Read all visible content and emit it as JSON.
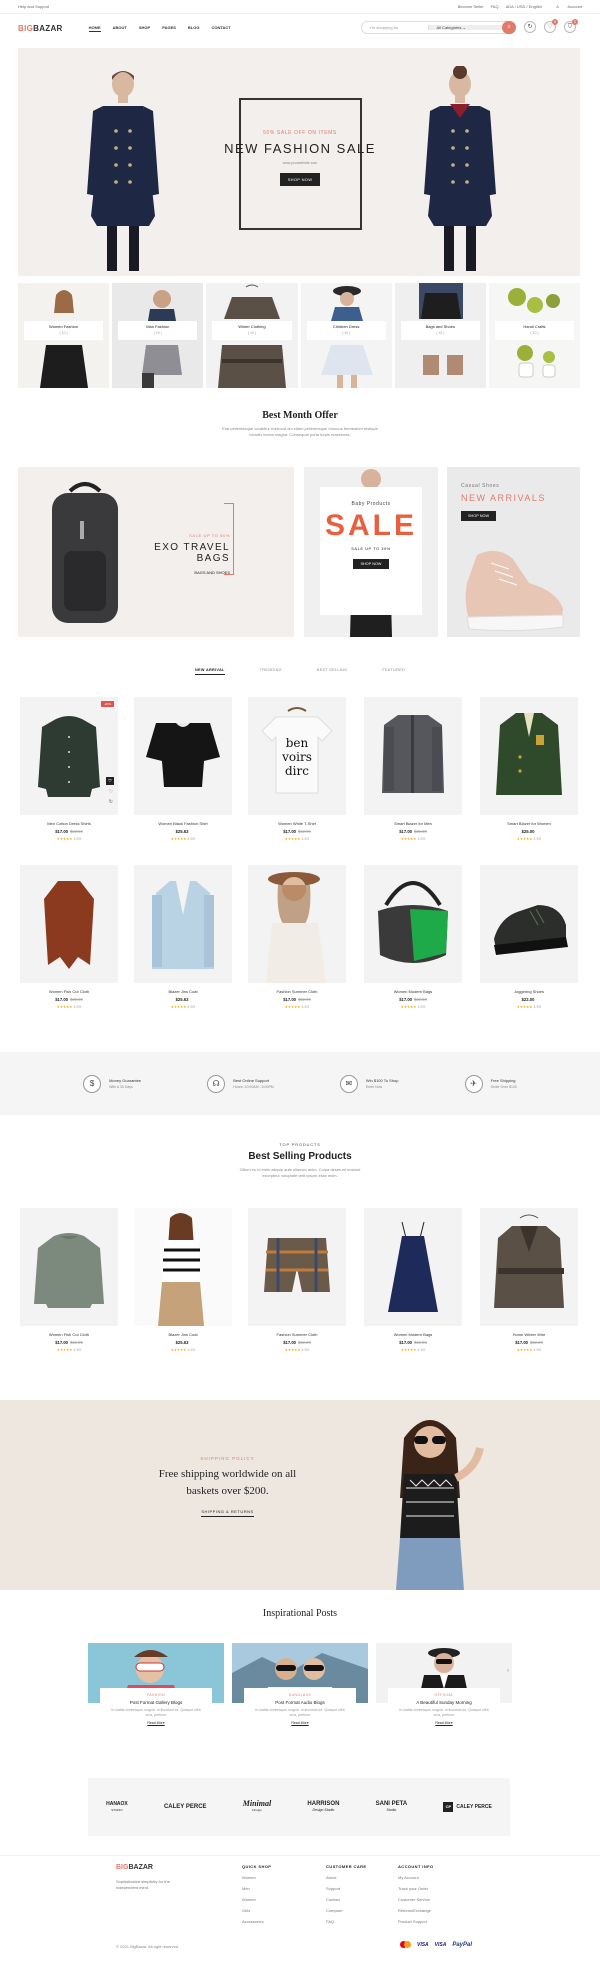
{
  "topbar": {
    "left": "Help and Support",
    "become_seller": "Become Seller",
    "faq": "FAQ",
    "locale": "ADA / USD / English",
    "account": "Account"
  },
  "header": {
    "logo_a": "BIG",
    "logo_b": "BAZAR",
    "nav": [
      "HOME",
      "ABOUT",
      "SHOP",
      "PAGES",
      "BLOG",
      "CONTACT"
    ],
    "search_placeholder": "I'm shopping for",
    "search_category": "All Categories",
    "cart_count": "0",
    "wish_count": "0"
  },
  "hero": {
    "subtitle": "50% SALE OFF ON ITEMS",
    "title": "NEW FASHION SALE",
    "website": "www.yourwebsite.com",
    "button": "SHOP NOW"
  },
  "categories": [
    {
      "name": "Women Fashion",
      "count": "( 10 )"
    },
    {
      "name": "Man Fashion",
      "count": "( 10 )"
    },
    {
      "name": "Winter Clothing",
      "count": "( 10 )"
    },
    {
      "name": "Children Dress",
      "count": "( 10 )"
    },
    {
      "name": "Bags and Shoes",
      "count": "( 10 )"
    },
    {
      "name": "Handi Crafts",
      "count": "( 10 )"
    }
  ],
  "offer": {
    "title": "Best Month Offer",
    "desc1": "Erat pellentesque curabitur euismod dui etiam pellentesque rhoncus fermentum tristique",
    "desc2": "lobortis lectus magna. Consequat porta turpis maecenas."
  },
  "banners": {
    "bags": {
      "kicker": "SALE UP TO 50%",
      "title": "EXO TRAVEL BAGS",
      "sub": "BAGS AND SHOES"
    },
    "sale": {
      "kicker": "Baby Products",
      "title": "SALE",
      "sub": "SALE UP TO 30%",
      "button": "SHOP NOW"
    },
    "shoes": {
      "kicker": "Casual Shoes",
      "title": "NEW ARRIVALS",
      "button": "SHOP NOW"
    }
  },
  "tabs": [
    "NEW ARRIVAL",
    "TRENDING",
    "BEST SELLING",
    "FEATURED"
  ],
  "products_row1": [
    {
      "name": "Men Cotton Dress Shirts",
      "price": "$17.00",
      "old": "$22.00",
      "rating": "★★★★★",
      "reviews": "4.9/5",
      "badge": "-20%"
    },
    {
      "name": "Women Black Fashion Shirt",
      "price": "$25.63",
      "old": "",
      "rating": "★★★★★",
      "reviews": "4.9/5"
    },
    {
      "name": "Women White T-Shirt",
      "price": "$17.00",
      "old": "$22.00",
      "rating": "★★★★★",
      "reviews": "4.9/5"
    },
    {
      "name": "Smart Blazer for Men",
      "price": "$17.00",
      "old": "$22.00",
      "rating": "★★★★★",
      "reviews": "4.9/5"
    },
    {
      "name": "Smart Blazer for Women",
      "price": "$25.00",
      "old": "",
      "rating": "★★★★★",
      "reviews": "4.9/5"
    }
  ],
  "products_row2": [
    {
      "name": "Women Fish Cut Cloth",
      "price": "$17.00",
      "old": "$22.00",
      "rating": "★★★★★",
      "reviews": "4.9/5"
    },
    {
      "name": "Blazer Jins Coat",
      "price": "$25.63",
      "old": "",
      "rating": "★★★★★",
      "reviews": "4.9/5"
    },
    {
      "name": "Fashion Summer Cloth",
      "price": "$17.00",
      "old": "$22.00",
      "rating": "★★★★★",
      "reviews": "4.9/5"
    },
    {
      "name": "Women Modern Bags",
      "price": "$17.00",
      "old": "$22.00",
      "rating": "★★★★★",
      "reviews": "4.9/5"
    },
    {
      "name": "Joggering Shoes",
      "price": "$22.00",
      "old": "",
      "rating": "★★★★★",
      "reviews": "4.9/5"
    }
  ],
  "features": [
    {
      "title": "Money Guarantee",
      "sub": "With A 30 Days",
      "icon": "money-icon"
    },
    {
      "title": "Best Online Support",
      "sub": "Hours: 10:00AM - 5:00PM",
      "icon": "headset-icon"
    },
    {
      "title": "Win $100 To Shop",
      "sub": "Enter Now",
      "icon": "gift-icon"
    },
    {
      "title": "Free Shipping",
      "sub": "Order Over $100",
      "icon": "plane-icon"
    }
  ],
  "bestselling": {
    "kicker": "TOP PRODUCTS",
    "title": "Best Selling Products",
    "desc1": "Cillum eu id enim aliquip aute ullamco anim. Culpa deserunt nostrud",
    "desc2": "excepteur voluptate velit ipsum esse enim."
  },
  "products_best": [
    {
      "name": "Women Fish Cut Cloth",
      "price": "$17.00",
      "old": "$22.00",
      "rating": "★★★★★",
      "reviews": "4.9/5"
    },
    {
      "name": "Blazer Jins Coat",
      "price": "$25.63",
      "old": "",
      "rating": "★★★★★",
      "reviews": "4.9/5"
    },
    {
      "name": "Fashion Summer Cloth",
      "price": "$17.00",
      "old": "$22.00",
      "rating": "★★★★★",
      "reviews": "4.9/5"
    },
    {
      "name": "Women Modern Bags",
      "price": "$17.00",
      "old": "$22.00",
      "rating": "★★★★★",
      "reviews": "4.9/5"
    },
    {
      "name": "Home Winter Wire",
      "price": "$17.00",
      "old": "$22.00",
      "rating": "★★★★★",
      "reviews": "4.9/5"
    }
  ],
  "shipping": {
    "kicker": "SHIPPING POLICY",
    "title1": "Free shipping worldwide on all",
    "title2": "baskets over $200.",
    "link": "SHIPPING & RETURNS"
  },
  "posts": {
    "title": "Inspirational Posts",
    "items": [
      {
        "cat": "FASHION",
        "title": "Post Format Gallery Blogs",
        "desc": "In mattis scelerisque magna, ut tincidunt ex. Quisque nibh urna, pretium.",
        "more": "Read More"
      },
      {
        "cat": "SUNGLASS",
        "title": "Post Format Audio Blogs",
        "desc": "In mattis scelerisque magna, ut tincidunt ex. Quisque nibh urna, pretium.",
        "more": "Read More"
      },
      {
        "cat": "OFFICIAL",
        "title": "A Beautiful Sunday Morning",
        "desc": "In mattis scelerisque magna, ut tincidunt ex. Quisque nibh urna, pretium.",
        "more": "Read More"
      }
    ]
  },
  "brands": [
    {
      "name": "HANAOX",
      "sub": "STUDIO"
    },
    {
      "name": "CALEY PERCE",
      "sub": ""
    },
    {
      "name": "Minimal",
      "sub": "Design"
    },
    {
      "name": "HARRISON",
      "sub": "Design Studio"
    },
    {
      "name": "SANI PETA",
      "sub": "Studio"
    },
    {
      "name": "CALEY PERCE",
      "sub": ""
    }
  ],
  "footer": {
    "logo_a": "BIG",
    "logo_b": "BAZAR",
    "about1": "Sophisticated simplicity for the",
    "about2": "independent mind.",
    "cols": [
      {
        "title": "QUICK SHOP",
        "items": [
          "Women",
          "Men",
          "Women",
          "Girls",
          "Accessories"
        ]
      },
      {
        "title": "CUSTOMER CARE",
        "items": [
          "About",
          "Support",
          "Contact",
          "Compare",
          "FAQ"
        ]
      },
      {
        "title": "ACCOUNT INFO",
        "items": [
          "My Account",
          "Track your Order",
          "Customer Service",
          "Returns/Exchange",
          "Product Support"
        ]
      }
    ],
    "copyright": "© 2021 BigBazar. All right reserved.",
    "payments": [
      "mastercard",
      "VISA",
      "VISA",
      "PayPal"
    ]
  }
}
